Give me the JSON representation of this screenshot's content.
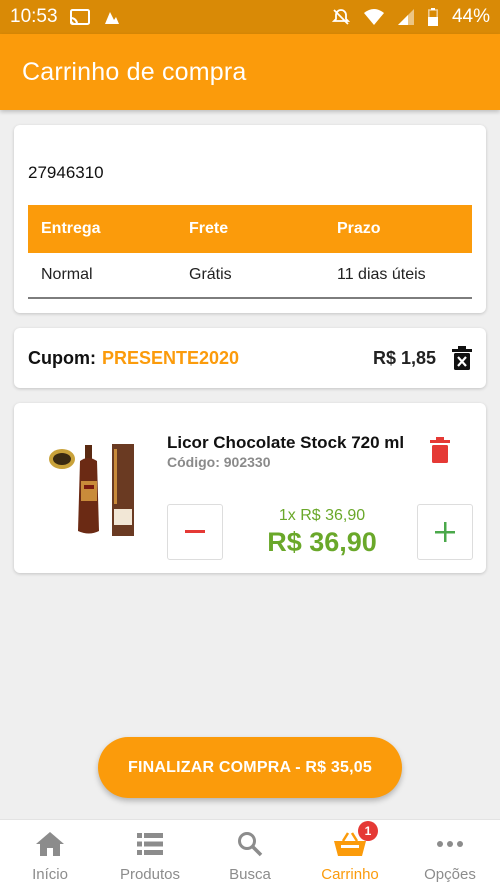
{
  "status_bar": {
    "time": "10:53",
    "battery": "44%"
  },
  "app_bar": {
    "title": "Carrinho de compra"
  },
  "shipping": {
    "cep": "27946310",
    "headers": [
      "Entrega",
      "Frete",
      "Prazo"
    ],
    "row": [
      "Normal",
      "Grátis",
      "11 dias úteis"
    ]
  },
  "coupon": {
    "label": "Cupom:",
    "code": "PRESENTE2020",
    "value": "R$ 1,85"
  },
  "product": {
    "name": "Licor Chocolate Stock 720 ml",
    "code": "Código: 902330",
    "unit_price": "1x R$ 36,90",
    "total": "R$ 36,90"
  },
  "checkout": {
    "label": "FINALIZAR COMPRA - R$ 35,05"
  },
  "nav": {
    "items": [
      {
        "label": "Início",
        "icon": "home-icon"
      },
      {
        "label": "Produtos",
        "icon": "list-icon"
      },
      {
        "label": "Busca",
        "icon": "search-icon"
      },
      {
        "label": "Carrinho",
        "icon": "basket-icon",
        "badge": "1"
      },
      {
        "label": "Opções",
        "icon": "more-icon"
      }
    ]
  },
  "colors": {
    "primary": "#fb9b0b",
    "status_bar": "#d98a06",
    "price": "#6aa82a",
    "danger": "#e53935"
  }
}
